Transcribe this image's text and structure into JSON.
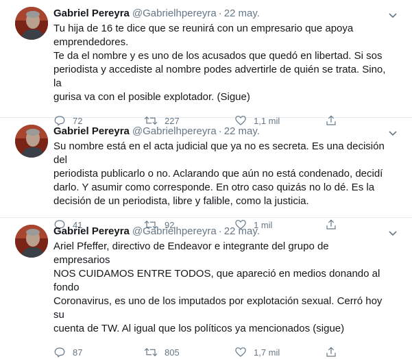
{
  "tweets": [
    {
      "name": "Gabriel Pereyra",
      "handle": "@Gabrielhpereyra",
      "separator": "·",
      "time": "22 may.",
      "text": "Tu hija de 16 te dice que se reunirá con un empresario que apoya\nemprendedores.\nTe da el nombre y es uno de los acusados que quedó en libertad. Si sos\nperiodista y accediste al nombre podes advertirle de quién se trata. Sino, la\ngurisa va con el posible explotador. (Sigue)",
      "replies": "72",
      "retweets": "227",
      "likes": "1,1 mil"
    },
    {
      "name": "Gabriel Pereyra",
      "handle": "@Gabrielhpereyra",
      "separator": "·",
      "time": "22 may.",
      "text": "Su nombre está en el acta judicial que ya no es secreta. Es una decisión del\nperiodista publicarlo o no. Aclarando que aún no está condenado, decidí\ndarlo. Y asumir como corresponde. En otro caso quizás no lo dé. Es la\ndecisión de un periodista, libre y falible, como la justicia.",
      "replies": "41",
      "retweets": "92",
      "likes": "1 mil"
    },
    {
      "name": "Gabriel Pereyra",
      "handle": "@Gabrielhpereyra",
      "separator": "·",
      "time": "22 may.",
      "text": "Ariel Pfeffer, directivo de Endeavor e integrante del grupo de empresarios\nNOS CUIDAMOS ENTRE TODOS, que apareció en medios donando al fondo\nCoronavirus, es uno de los imputados por explotación sexual. Cerró hoy su\ncuenta de TW. Al igual que los políticos ya mencionados (sigue)",
      "replies": "87",
      "retweets": "805",
      "likes": "1,7 mil"
    }
  ],
  "icons": {
    "reply": "reply-icon",
    "retweet": "retweet-icon",
    "like": "heart-icon",
    "share": "share-icon",
    "more": "chevron-down-icon"
  },
  "colors": {
    "text": "#14171a",
    "secondary": "#657786",
    "divider": "#e6ecf0"
  }
}
